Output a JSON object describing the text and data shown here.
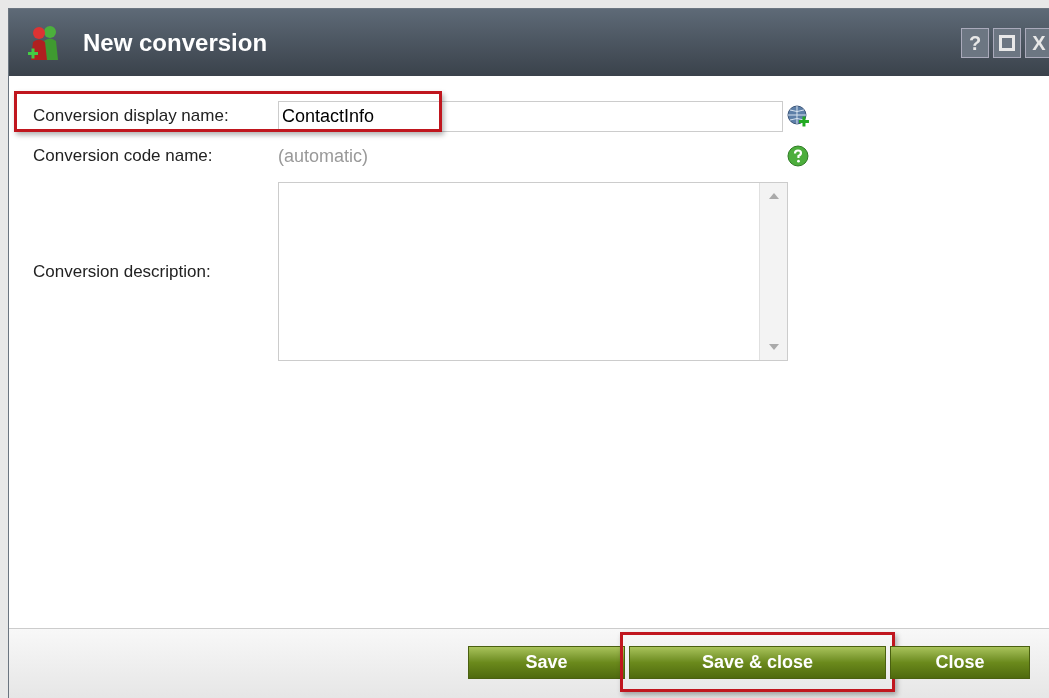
{
  "window": {
    "title": "New conversion",
    "controls": [
      {
        "kind": "help",
        "label": "?"
      },
      {
        "kind": "maximize"
      },
      {
        "kind": "close",
        "label": "X"
      }
    ]
  },
  "fields": [
    {
      "kind": "text",
      "label": "Conversion display name:",
      "value": "ContactInfo",
      "highlighted": true
    },
    {
      "kind": "static",
      "label": "Conversion code name:",
      "value": "(automatic)",
      "highlighted": false
    },
    {
      "kind": "textarea",
      "label": "Conversion description:",
      "highlighted": false
    }
  ],
  "buttons": [
    {
      "label": "Save",
      "highlighted": false
    },
    {
      "label": "Save & close",
      "highlighted": true
    },
    {
      "label": "Close",
      "highlighted": false
    }
  ]
}
